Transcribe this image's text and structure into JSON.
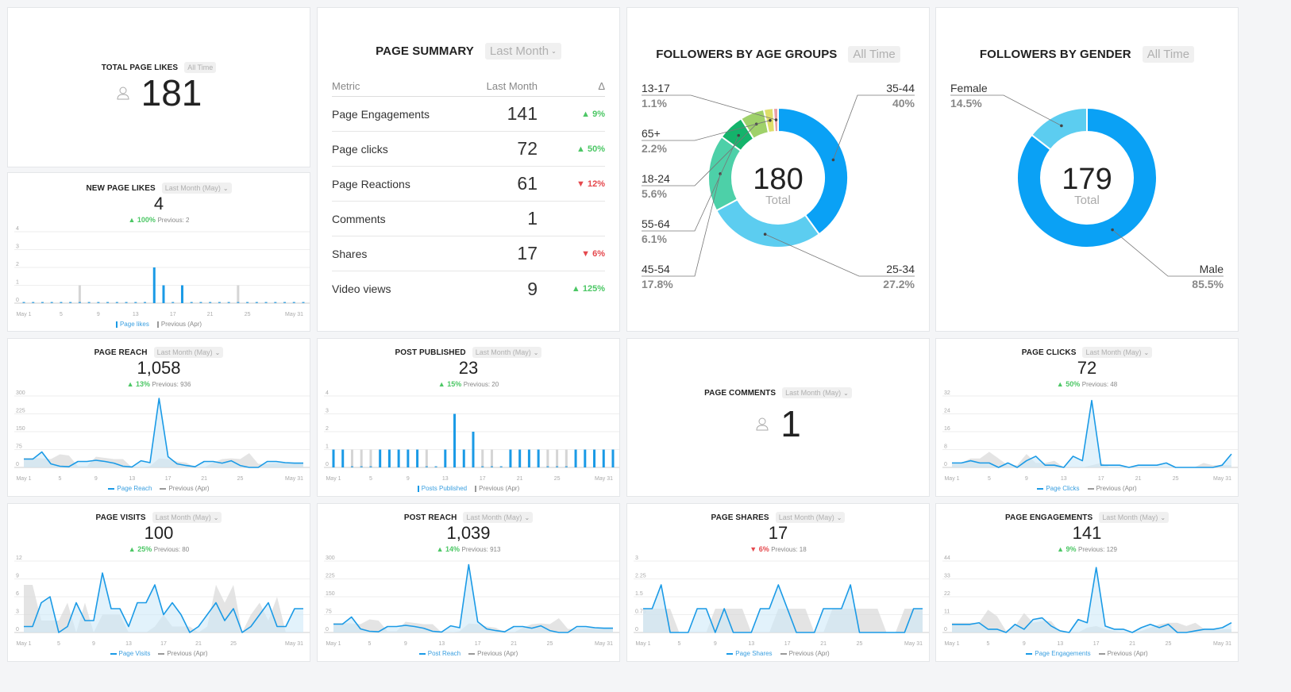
{
  "cards": {
    "total_likes": {
      "title": "TOTAL PAGE LIKES",
      "range": "All Time",
      "value": "181",
      "icon": "person-icon"
    },
    "page_summary": {
      "title": "PAGE SUMMARY",
      "range": "Last Month",
      "columns": [
        "Metric",
        "Last Month",
        "Δ"
      ],
      "rows": [
        {
          "metric": "Page Engagements",
          "value": "141",
          "delta": "▲ 9%",
          "dir": "up"
        },
        {
          "metric": "Page clicks",
          "value": "72",
          "delta": "▲ 50%",
          "dir": "up"
        },
        {
          "metric": "Page Reactions",
          "value": "61",
          "delta": "▼ 12%",
          "dir": "down"
        },
        {
          "metric": "Comments",
          "value": "1",
          "delta": "",
          "dir": ""
        },
        {
          "metric": "Shares",
          "value": "17",
          "delta": "▼ 6%",
          "dir": "down"
        },
        {
          "metric": "Video views",
          "value": "9",
          "delta": "▲ 125%",
          "dir": "up"
        }
      ]
    },
    "age_groups": {
      "title": "FOLLOWERS BY AGE GROUPS",
      "range": "All Time",
      "total": "180",
      "total_label": "Total"
    },
    "gender": {
      "title": "FOLLOWERS BY GENDER",
      "range": "All Time",
      "total": "179",
      "total_label": "Total"
    },
    "page_comments": {
      "title": "PAGE COMMENTS",
      "range": "Last Month (May)",
      "value": "1",
      "icon": "person-icon"
    }
  },
  "colors": {
    "current": "#1a9ae6",
    "previous": "#d5d5d5",
    "up": "#4cc765",
    "down": "#e5484d"
  },
  "chart_data": [
    {
      "id": "new_page_likes",
      "type": "bar",
      "title": "NEW PAGE LIKES",
      "range": "Last Month (May)",
      "value": "4",
      "delta": "▲ 100%",
      "dir": "up",
      "previous_text": "Previous: 2",
      "yticks": [
        "0",
        "1",
        "2",
        "3",
        "4"
      ],
      "ylim": [
        0,
        4
      ],
      "xticks": [
        "May 1",
        "5",
        "9",
        "13",
        "17",
        "21",
        "25",
        "May 31"
      ],
      "legend": [
        "Page likes",
        "Previous (Apr)"
      ],
      "series": [
        {
          "name": "Page likes",
          "values": [
            0,
            0,
            0,
            0,
            0,
            0,
            0,
            0,
            0,
            0,
            0,
            0,
            0,
            0,
            2,
            1,
            0,
            1,
            0,
            0,
            0,
            0,
            0,
            0,
            0,
            0,
            0,
            0,
            0,
            0,
            0
          ]
        },
        {
          "name": "Previous (Apr)",
          "values": [
            0,
            0,
            0,
            0,
            0,
            0,
            1,
            0,
            0,
            0,
            0,
            0,
            0,
            0,
            0,
            0,
            0,
            0,
            0,
            0,
            0,
            0,
            0,
            1,
            0,
            0,
            0,
            0,
            0,
            0,
            0
          ]
        }
      ]
    },
    {
      "id": "page_reach",
      "type": "area",
      "title": "PAGE REACH",
      "range": "Last Month (May)",
      "value": "1,058",
      "delta": "▲ 13%",
      "dir": "up",
      "previous_text": "Previous: 936",
      "yticks": [
        "0",
        "75",
        "150",
        "225",
        "300"
      ],
      "ylim": [
        0,
        300
      ],
      "xticks": [
        "May 1",
        "5",
        "9",
        "13",
        "17",
        "21",
        "25",
        "May 31"
      ],
      "legend": [
        "Page Reach",
        "Previous (Apr)"
      ],
      "series": [
        {
          "name": "Page Reach",
          "values": [
            35,
            35,
            65,
            15,
            5,
            3,
            25,
            25,
            30,
            25,
            18,
            5,
            2,
            28,
            20,
            290,
            45,
            15,
            8,
            3,
            25,
            25,
            18,
            28,
            8,
            0,
            0,
            25,
            25,
            20,
            18,
            18
          ]
        },
        {
          "name": "Previous (Apr)",
          "values": [
            40,
            40,
            38,
            35,
            55,
            50,
            5,
            5,
            45,
            40,
            35,
            35,
            0,
            0,
            5,
            38,
            35,
            25,
            20,
            0,
            0,
            20,
            35,
            38,
            35,
            60,
            15,
            15,
            18,
            20,
            20,
            20
          ]
        }
      ]
    },
    {
      "id": "post_published",
      "type": "bar",
      "title": "POST PUBLISHED",
      "range": "Last Month (May)",
      "value": "23",
      "delta": "▲ 15%",
      "dir": "up",
      "previous_text": "Previous: 20",
      "yticks": [
        "0",
        "1",
        "2",
        "3",
        "4"
      ],
      "ylim": [
        0,
        4
      ],
      "xticks": [
        "May 1",
        "5",
        "9",
        "13",
        "17",
        "21",
        "25",
        "May 31"
      ],
      "legend": [
        "Posts Published",
        "Previous (Apr)"
      ],
      "series": [
        {
          "name": "Posts Published",
          "values": [
            1,
            1,
            0,
            0,
            0,
            1,
            1,
            1,
            1,
            1,
            0,
            0,
            1,
            3,
            1,
            2,
            0,
            0,
            0,
            1,
            1,
            1,
            1,
            0,
            0,
            0,
            1,
            1,
            1,
            1,
            1
          ]
        },
        {
          "name": "Previous (Apr)",
          "values": [
            0,
            0,
            1,
            1,
            1,
            0,
            0,
            0,
            0,
            0,
            1,
            0,
            0,
            0,
            0,
            1,
            1,
            1,
            0,
            0,
            0,
            0,
            0,
            1,
            1,
            1,
            0,
            0,
            0,
            0,
            0
          ]
        }
      ]
    },
    {
      "id": "page_clicks",
      "type": "area",
      "title": "PAGE CLICKS",
      "range": "Last Month (May)",
      "value": "72",
      "delta": "▲ 50%",
      "dir": "up",
      "previous_text": "Previous: 48",
      "yticks": [
        "0",
        "8",
        "16",
        "24",
        "32"
      ],
      "ylim": [
        0,
        32
      ],
      "xticks": [
        "May 1",
        "5",
        "9",
        "13",
        "17",
        "21",
        "25",
        "May 31"
      ],
      "legend": [
        "Page Clicks",
        "Previous (Apr)"
      ],
      "series": [
        {
          "name": "Page Clicks",
          "values": [
            2,
            2,
            3,
            2,
            2,
            0,
            2,
            0,
            3,
            5,
            1,
            1,
            0,
            5,
            3,
            30,
            1,
            1,
            1,
            0,
            1,
            1,
            1,
            2,
            0,
            0,
            0,
            0,
            0,
            1,
            6
          ]
        },
        {
          "name": "Previous (Apr)",
          "values": [
            2,
            2,
            4,
            4,
            7,
            4,
            1,
            1,
            6,
            2,
            2,
            3,
            0,
            0,
            0,
            1,
            2,
            0,
            0,
            0,
            0,
            0,
            0,
            0,
            0,
            0,
            0,
            2,
            1,
            1,
            1
          ]
        }
      ]
    },
    {
      "id": "page_visits",
      "type": "area",
      "title": "PAGE VISITS",
      "range": "Last Month (May)",
      "value": "100",
      "delta": "▲ 25%",
      "dir": "up",
      "previous_text": "Previous: 80",
      "yticks": [
        "0",
        "3",
        "6",
        "9",
        "12"
      ],
      "ylim": [
        0,
        12
      ],
      "xticks": [
        "May 1",
        "5",
        "9",
        "13",
        "17",
        "21",
        "25",
        "May 31"
      ],
      "legend": [
        "Page Visits",
        "Previous (Apr)"
      ],
      "series": [
        {
          "name": "Page Visits",
          "values": [
            1,
            1,
            5,
            6,
            0,
            1,
            5,
            2,
            2,
            10,
            4,
            4,
            1,
            5,
            5,
            8,
            3,
            5,
            3,
            0,
            1,
            3,
            5,
            2,
            4,
            0,
            1,
            3,
            5,
            1,
            1,
            4,
            4
          ]
        },
        {
          "name": "Previous (Apr)",
          "values": [
            8,
            8,
            2,
            2,
            2,
            5,
            0,
            5,
            0,
            3,
            3,
            3,
            0,
            0,
            0,
            1,
            3,
            1,
            1,
            1,
            0,
            1,
            8,
            5,
            8,
            0,
            3,
            5,
            2,
            6,
            0,
            0,
            0
          ]
        }
      ]
    },
    {
      "id": "post_reach",
      "type": "area",
      "title": "POST REACH",
      "range": "Last Month (May)",
      "value": "1,039",
      "delta": "▲ 14%",
      "dir": "up",
      "previous_text": "Previous: 913",
      "yticks": [
        "0",
        "75",
        "150",
        "225",
        "300"
      ],
      "ylim": [
        0,
        300
      ],
      "xticks": [
        "May 1",
        "5",
        "9",
        "13",
        "17",
        "21",
        "25",
        "May 31"
      ],
      "legend": [
        "Post Reach",
        "Previous (Apr)"
      ],
      "series": [
        {
          "name": "Post Reach",
          "values": [
            35,
            35,
            65,
            15,
            5,
            3,
            25,
            25,
            30,
            25,
            18,
            5,
            2,
            28,
            20,
            285,
            45,
            15,
            8,
            3,
            25,
            25,
            18,
            28,
            8,
            0,
            0,
            25,
            25,
            20,
            18,
            18
          ]
        },
        {
          "name": "Previous (Apr)",
          "values": [
            40,
            40,
            38,
            35,
            55,
            50,
            5,
            5,
            45,
            40,
            35,
            35,
            0,
            0,
            5,
            38,
            35,
            25,
            20,
            0,
            0,
            20,
            35,
            38,
            35,
            60,
            15,
            15,
            18,
            20,
            20,
            20
          ]
        }
      ]
    },
    {
      "id": "page_shares",
      "type": "area",
      "title": "PAGE SHARES",
      "range": "Last Month (May)",
      "value": "17",
      "delta": "▼ 6%",
      "dir": "down",
      "previous_text": "Previous: 18",
      "yticks": [
        "0",
        "0.75",
        "1.5",
        "2.25",
        "3"
      ],
      "ylim": [
        0,
        3
      ],
      "xticks": [
        "May 1",
        "5",
        "9",
        "13",
        "17",
        "21",
        "25",
        "May 31"
      ],
      "legend": [
        "Page Shares",
        "Previous (Apr)"
      ],
      "series": [
        {
          "name": "Page Shares",
          "values": [
            1,
            1,
            2,
            0,
            0,
            0,
            1,
            1,
            0,
            1,
            0,
            0,
            0,
            1,
            1,
            2,
            1,
            0,
            0,
            0,
            1,
            1,
            1,
            2,
            0,
            0,
            0,
            0,
            0,
            0,
            1,
            1
          ]
        },
        {
          "name": "Previous (Apr)",
          "values": [
            1,
            1,
            1,
            1,
            0,
            0,
            0,
            0,
            1,
            1,
            1,
            1,
            0,
            0,
            0,
            1,
            1,
            1,
            1,
            0,
            0,
            1,
            1,
            1,
            1,
            1,
            1,
            0,
            0,
            1,
            1,
            1
          ]
        }
      ]
    },
    {
      "id": "page_engagements",
      "type": "area",
      "title": "PAGE ENGAGEMENTS",
      "range": "Last Month (May)",
      "value": "141",
      "delta": "▲ 9%",
      "dir": "up",
      "previous_text": "Previous: 129",
      "yticks": [
        "0",
        "11",
        "22",
        "33",
        "44"
      ],
      "ylim": [
        0,
        44
      ],
      "xticks": [
        "May 1",
        "5",
        "9",
        "13",
        "17",
        "21",
        "25",
        "May 31"
      ],
      "legend": [
        "Page Engagements",
        "Previous (Apr)"
      ],
      "series": [
        {
          "name": "Page Engagements",
          "values": [
            5,
            5,
            5,
            6,
            2,
            2,
            0,
            5,
            2,
            8,
            9,
            4,
            1,
            0,
            8,
            6,
            40,
            4,
            2,
            2,
            0,
            3,
            5,
            3,
            5,
            0,
            0,
            1,
            2,
            2,
            3,
            6
          ]
        },
        {
          "name": "Previous (Apr)",
          "values": [
            6,
            6,
            6,
            6,
            14,
            10,
            1,
            4,
            12,
            6,
            7,
            7,
            0,
            0,
            0,
            3,
            4,
            2,
            1,
            0,
            0,
            1,
            3,
            5,
            6,
            6,
            4,
            6,
            2,
            2,
            2,
            2
          ]
        }
      ]
    },
    {
      "id": "followers_by_age",
      "type": "pie",
      "title": "FOLLOWERS BY AGE GROUPS",
      "labels": [
        "35-44",
        "25-34",
        "45-54",
        "55-64",
        "18-24",
        "65+",
        "13-17"
      ],
      "values": [
        40,
        27.2,
        17.8,
        6.1,
        5.6,
        2.2,
        1.1
      ],
      "pct_labels": [
        "40%",
        "27.2%",
        "17.8%",
        "6.1%",
        "5.6%",
        "2.2%",
        "1.1%"
      ],
      "colors": [
        "#0aa1f5",
        "#5ccdf0",
        "#4dd0a8",
        "#14b36b",
        "#9fd16a",
        "#dede6a",
        "#e8a0a8"
      ]
    },
    {
      "id": "followers_by_gender",
      "type": "pie",
      "title": "FOLLOWERS BY GENDER",
      "labels": [
        "Male",
        "Female"
      ],
      "values": [
        85.5,
        14.5
      ],
      "pct_labels": [
        "85.5%",
        "14.5%"
      ],
      "colors": [
        "#0aa1f5",
        "#5ccdf0"
      ]
    }
  ]
}
